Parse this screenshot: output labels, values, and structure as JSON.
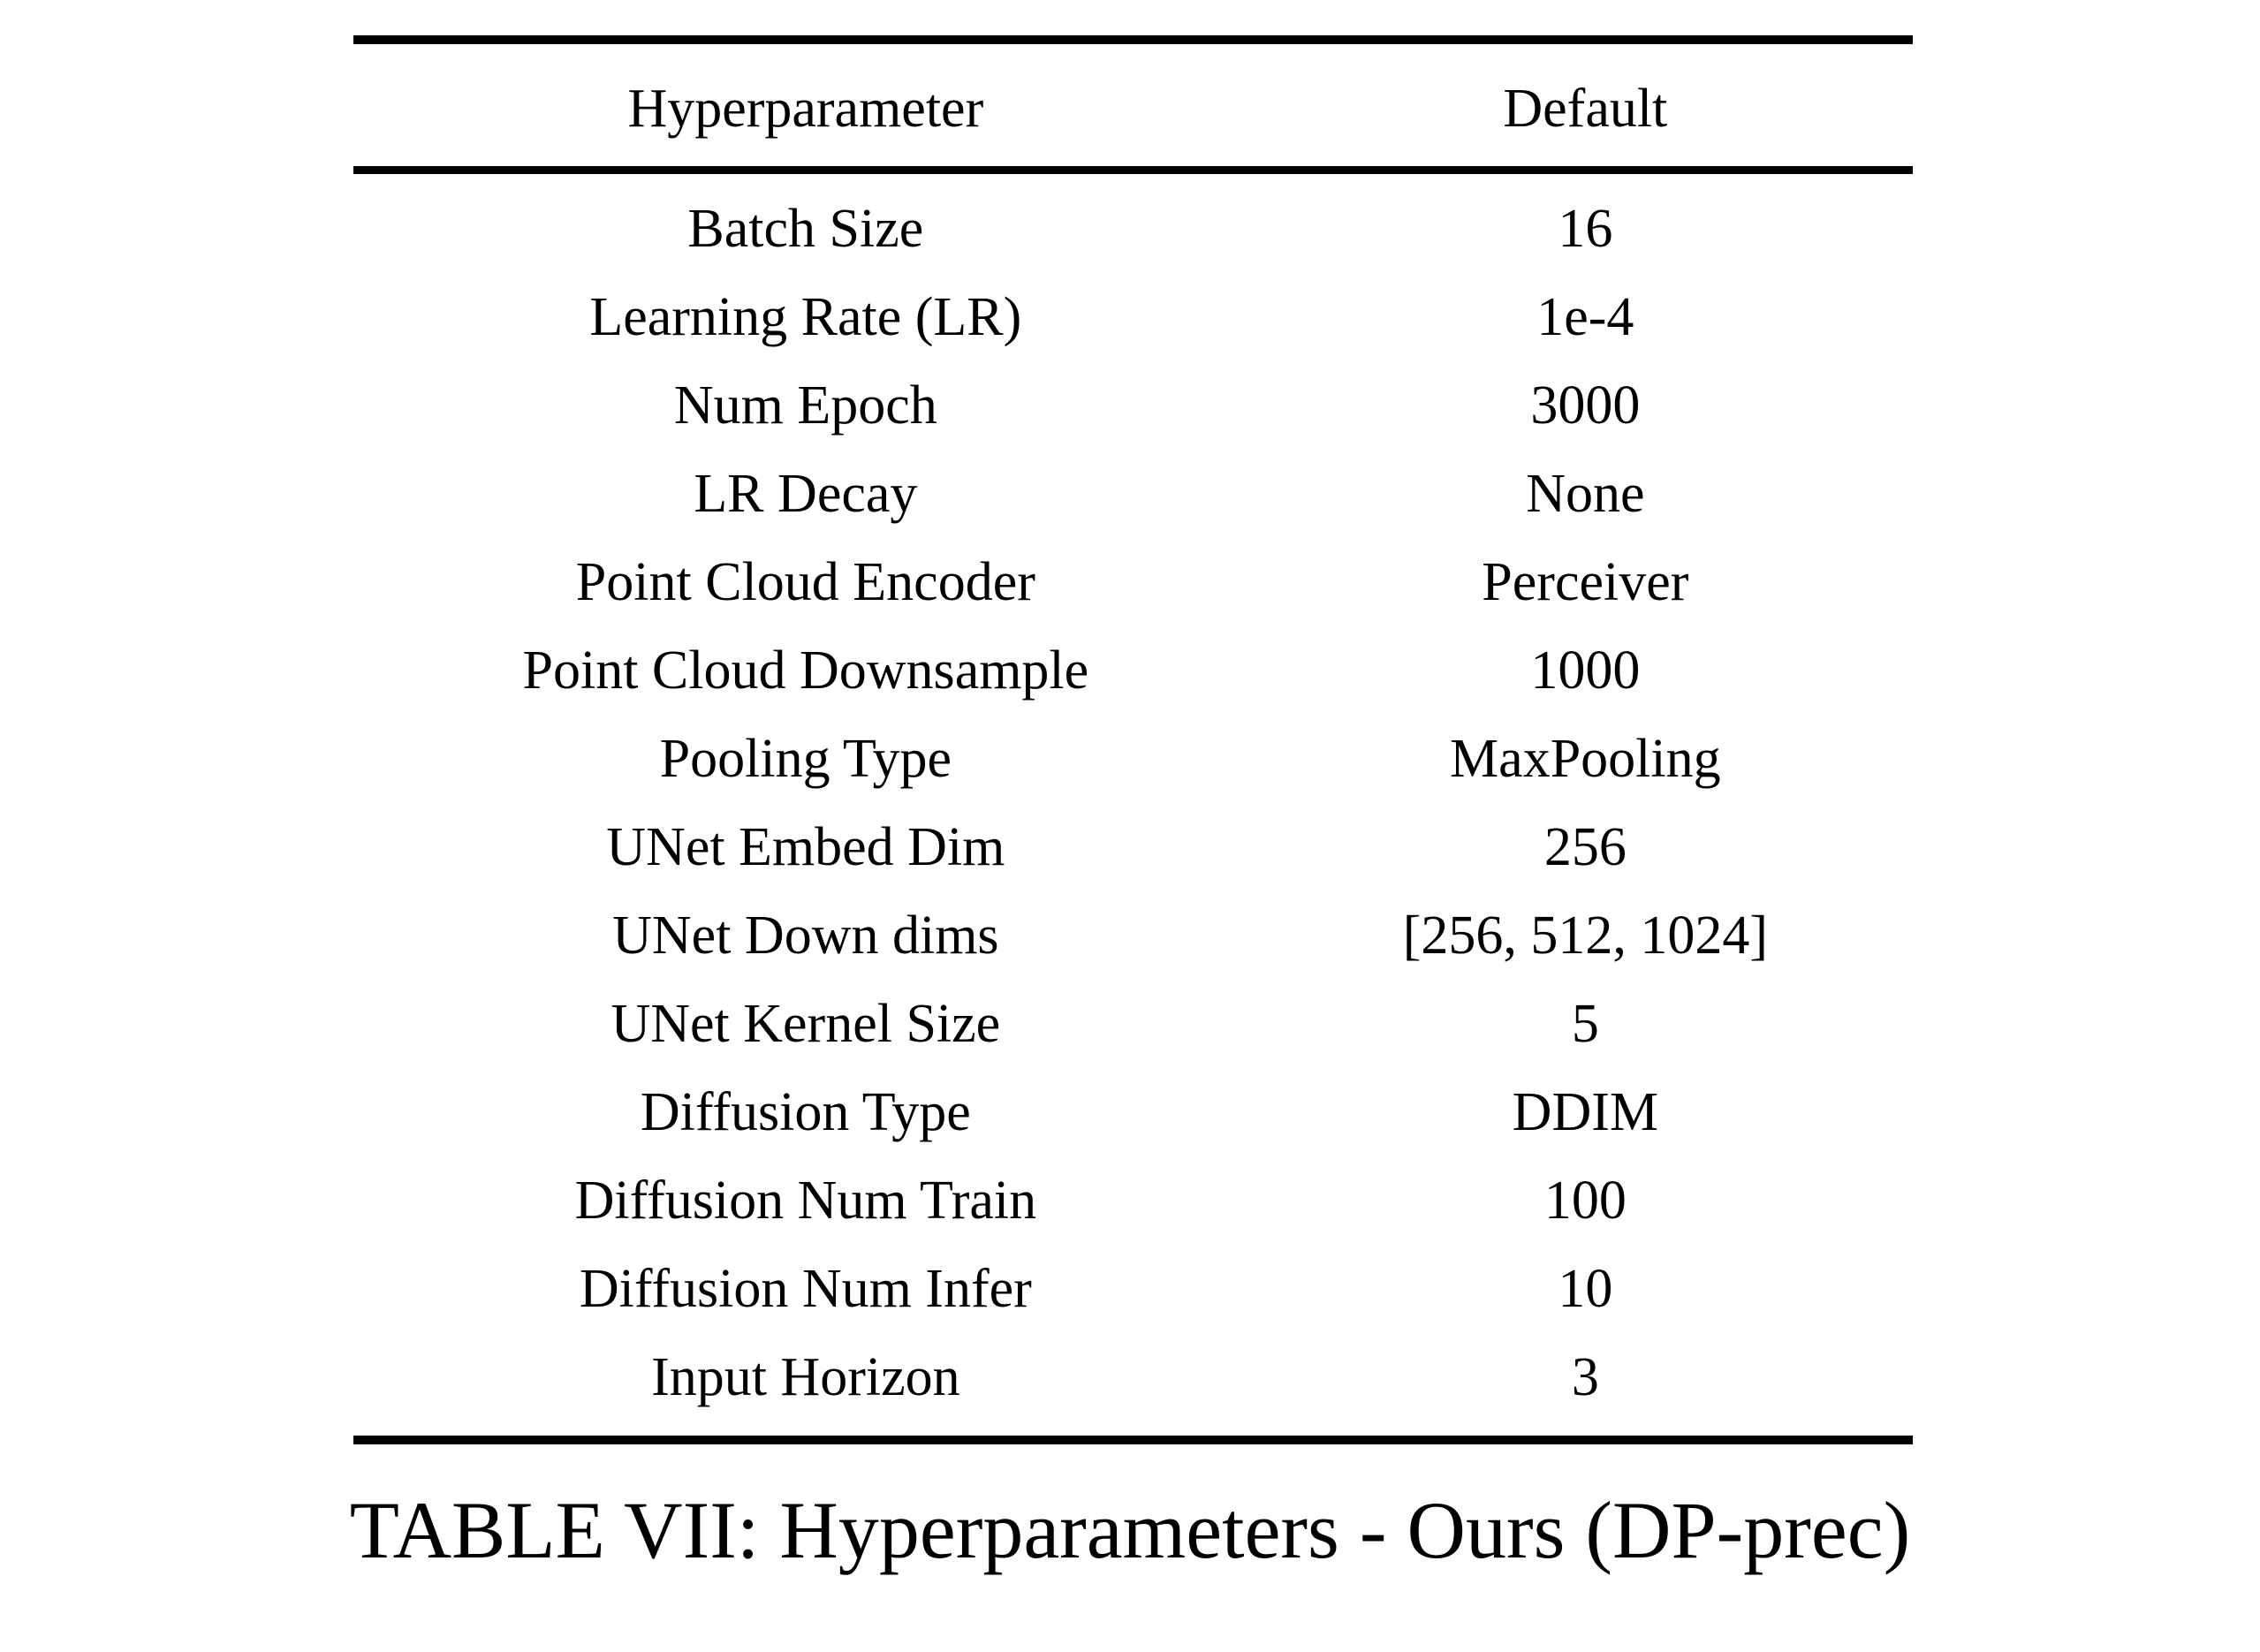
{
  "table": {
    "caption": "TABLE VII: Hyperparameters - Ours (DP-prec)",
    "columns": [
      "Hyperparameter",
      "Default"
    ],
    "rows": [
      {
        "parameter": "Batch Size",
        "value": "16"
      },
      {
        "parameter": "Learning Rate (LR)",
        "value": "1e-4"
      },
      {
        "parameter": "Num Epoch",
        "value": "3000"
      },
      {
        "parameter": "LR Decay",
        "value": "None"
      },
      {
        "parameter": "Point Cloud Encoder",
        "value": "Perceiver"
      },
      {
        "parameter": "Point Cloud Downsample",
        "value": "1000"
      },
      {
        "parameter": "Pooling Type",
        "value": "MaxPooling"
      },
      {
        "parameter": "UNet Embed Dim",
        "value": "256"
      },
      {
        "parameter": "UNet Down dims",
        "value": "[256, 512, 1024]"
      },
      {
        "parameter": "UNet Kernel Size",
        "value": "5"
      },
      {
        "parameter": "Diffusion Type",
        "value": "DDIM"
      },
      {
        "parameter": "Diffusion Num Train",
        "value": "100"
      },
      {
        "parameter": "Diffusion Num Infer",
        "value": "10"
      },
      {
        "parameter": "Input Horizon",
        "value": "3"
      }
    ],
    "colors": {
      "rule": "#000000",
      "text": "#000000",
      "background": "#ffffff"
    }
  }
}
